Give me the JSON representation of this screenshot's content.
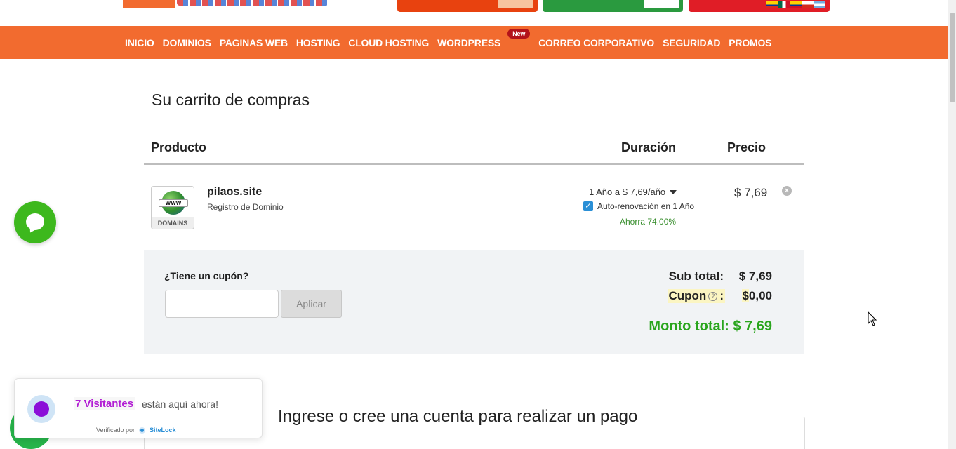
{
  "nav": {
    "items": [
      "INICIO",
      "DOMINIOS",
      "PAGINAS WEB",
      "HOSTING",
      "CLOUD HOSTING",
      "WORDPRESS",
      "CORREO CORPORATIVO",
      "SEGURIDAD",
      "PROMOS"
    ],
    "badge": "New"
  },
  "cart": {
    "title": "Su carrito de compras",
    "headers": {
      "product": "Producto",
      "duration": "Duración",
      "price": "Precio"
    },
    "item": {
      "icon_label": "DOMAINS",
      "icon_band": "WWW",
      "name": "pilaos.site",
      "type": "Registro de Dominio",
      "duration": "1 Año a $ 7,69/año",
      "autorenew": "Auto-renovación en 1 Año",
      "savings": "Ahorra 74.00%",
      "price": "$ 7,69"
    },
    "coupon": {
      "label": "¿Tiene un cupón?",
      "input_value": "",
      "apply_label": "Aplicar"
    },
    "summary": {
      "subtotal_label": "Sub total:",
      "subtotal_value": "$ 7,69",
      "coupon_label": "Cupon",
      "coupon_colon": ":",
      "coupon_currency": "$",
      "coupon_value": "0,00",
      "total": "Monto total: $ 7,69"
    }
  },
  "account": {
    "title": "Ingrese o cree una cuenta para realizar un pago"
  },
  "visitors": {
    "count": "7 Visitantes",
    "text": "están aquí ahora!",
    "verified_by": "Verificado por",
    "brand": "SiteLock"
  },
  "colors": {
    "brand_orange": "#f26b2f",
    "total_green": "#2aa51d",
    "chat_green": "#3db81d"
  }
}
